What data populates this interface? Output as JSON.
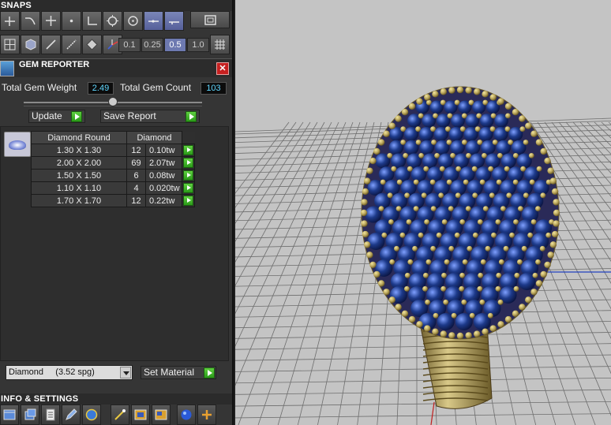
{
  "snaps": {
    "title": "SNAPS",
    "row1_icons": [
      "snap-end-icon",
      "snap-curve-icon",
      "snap-intersection-icon",
      "snap-point-icon",
      "snap-perpendicular-icon",
      "snap-quadrant-icon",
      "snap-center-icon",
      "snap-near-icon",
      "snap-tangent-icon",
      "snap-window-icon"
    ],
    "row2_icons": [
      "grid-icon",
      "cube-icon",
      "line-icon",
      "edit-curve-icon",
      "direction-icon",
      "axis-icon"
    ],
    "grid_steps": [
      "0.1",
      "0.25",
      "0.5",
      "1.0"
    ],
    "selected_step": "0.5"
  },
  "gem_reporter": {
    "title": "GEM REPORTER",
    "weight_label": "Total Gem Weight",
    "weight_value": "2.49",
    "count_label": "Total Gem Count",
    "count_value": "103",
    "update_label": "Update",
    "save_report_label": "Save Report",
    "table": {
      "header_shape": "Diamond Round",
      "header_material": "Diamond",
      "rows": [
        {
          "size": "1.30 X 1.30",
          "count": "12",
          "weight": "0.10tw"
        },
        {
          "size": "2.00 X 2.00",
          "count": "69",
          "weight": "2.07tw"
        },
        {
          "size": "1.50 X 1.50",
          "count": "6",
          "weight": "0.08tw"
        },
        {
          "size": "1.10 X 1.10",
          "count": "4",
          "weight": "0.020tw"
        },
        {
          "size": "1.70 X 1.70",
          "count": "12",
          "weight": "0.22tw"
        }
      ]
    },
    "material_select": "Diamond     (3.52 spg)",
    "set_material_label": "Set Material"
  },
  "info": {
    "title": "INFO & SETTINGS",
    "icons": [
      "window-icon",
      "layers-icon",
      "document-icon",
      "pencil-icon",
      "globe-icon",
      "wand-icon",
      "render-icon",
      "render-alt-icon",
      "sphere-icon",
      "add-icon"
    ]
  },
  "colors": {
    "gem_blue": "#1d3a8a",
    "metal_gold": "#b8a45a",
    "viewport_bg": "#c4c4c4"
  }
}
